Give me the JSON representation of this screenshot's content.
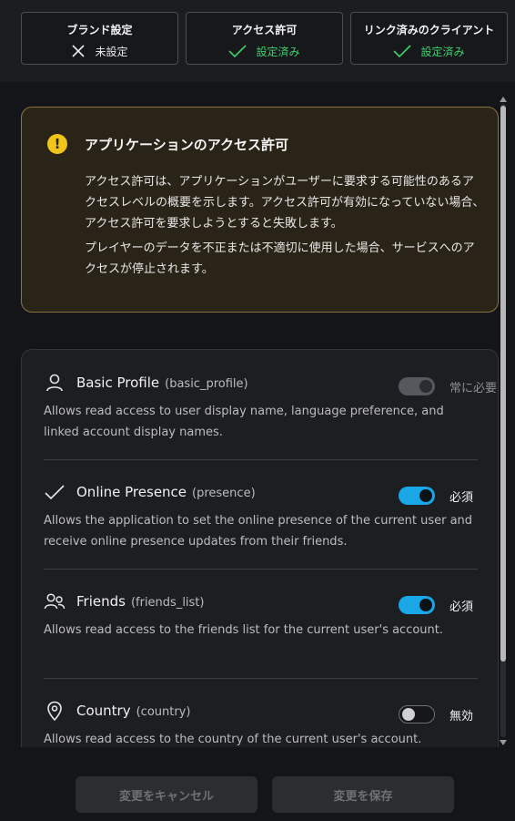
{
  "status": [
    {
      "title": "ブランド設定",
      "value": "未設定",
      "state": "not-set",
      "icon": "x-icon"
    },
    {
      "title": "アクセス許可",
      "value": "設定済み",
      "state": "set",
      "icon": "check-icon"
    },
    {
      "title": "リンク済みのクライアント",
      "value": "設定済み",
      "state": "set",
      "icon": "check-icon"
    }
  ],
  "warning": {
    "icon": "warning-icon",
    "title": "アプリケーションのアクセス許可",
    "para1": "アクセス許可は、アプリケーションがユーザーに要求する可能性のあるアクセスレベルの概要を示します。アクセス許可が有効になっていない場合、アクセス許可を要求しようとすると失敗します。",
    "para2": "プレイヤーのデータを不正または不適切に使用した場合、サービスへのアクセスが停止されます。"
  },
  "permissions": [
    {
      "icon": "user-icon",
      "name": "Basic Profile",
      "code": "(basic_profile)",
      "desc": "Allows read access to user display name, language preference, and linked account display names.",
      "toggle": "locked",
      "status": "常に必要"
    },
    {
      "icon": "check-icon",
      "name": "Online Presence",
      "code": "(presence)",
      "desc": "Allows the application to set the online presence of the current user and receive online presence updates from their friends.",
      "toggle": "on",
      "status": "必須"
    },
    {
      "icon": "friends-icon",
      "name": "Friends",
      "code": "(friends_list)",
      "desc": "Allows read access to the friends list for the current user's account.",
      "toggle": "on",
      "status": "必須"
    },
    {
      "icon": "location-pin-icon",
      "name": "Country",
      "code": "(country)",
      "desc": "Allows read access to the country of the current user's account.",
      "toggle": "off",
      "status": "無効"
    }
  ],
  "footer": {
    "cancel_label": "変更をキャンセル",
    "save_label": "変更を保存"
  },
  "colors": {
    "accent": "#1aa7e8",
    "success": "#3ed16b",
    "warning": "#f0c419"
  }
}
